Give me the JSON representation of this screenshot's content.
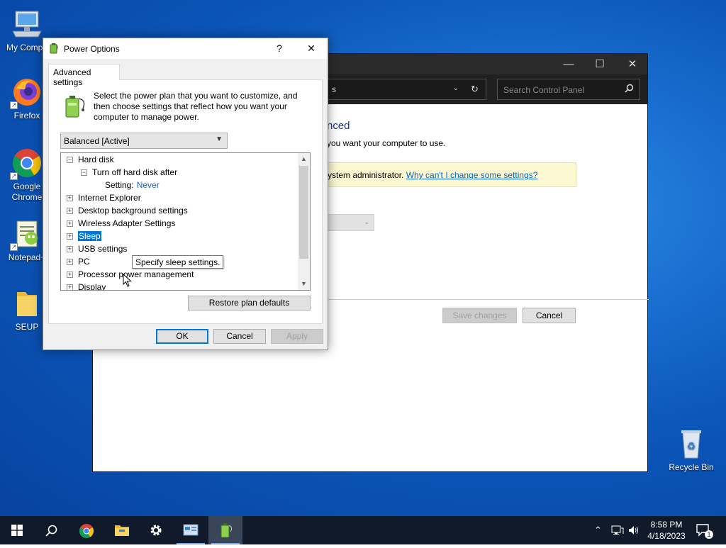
{
  "desktop": {
    "icons": [
      {
        "label": "My Compu",
        "icon": "computer-icon"
      },
      {
        "label": "Firefox",
        "icon": "firefox-icon"
      },
      {
        "label": "Google Chrome",
        "icon": "chrome-icon"
      },
      {
        "label": "Notepad+",
        "icon": "notepadpp-icon"
      },
      {
        "label": "SEUP",
        "icon": "folder-icon"
      },
      {
        "label": "Recycle Bin",
        "icon": "recycle-bin-icon"
      }
    ]
  },
  "control_panel": {
    "address_text": "s",
    "search_placeholder": "Search Control Panel",
    "title": "nced",
    "description": "you want your computer to use.",
    "info_text": "ystem administrator. ",
    "info_link": "Why can't I change some settings?",
    "save_label": "Save changes",
    "cancel_label": "Cancel"
  },
  "dialog": {
    "title": "Power Options",
    "help_glyph": "?",
    "close_glyph": "✕",
    "tab_label": "Advanced settings",
    "description": "Select the power plan that you want to customize, and then choose settings that reflect how you want your computer to manage power.",
    "plan_selected": "Balanced [Active]",
    "tree": {
      "hard_disk": "Hard disk",
      "turn_off_hard_disk": "Turn off hard disk after",
      "setting_label": "Setting:",
      "setting_value": "Never",
      "internet_explorer": "Internet Explorer",
      "desktop_background": "Desktop background settings",
      "wireless_adapter": "Wireless Adapter Settings",
      "sleep": "Sleep",
      "usb": "USB settings",
      "pci": "PC",
      "processor": "Processor power management",
      "display": "Display"
    },
    "tooltip": "Specify sleep settings.",
    "restore_label": "Restore plan defaults",
    "ok_label": "OK",
    "cancel_label": "Cancel",
    "apply_label": "Apply"
  },
  "taskbar": {
    "time": "8:58 PM",
    "date": "4/18/2023",
    "notification_count": "1",
    "apps": [
      "start-icon",
      "search-icon",
      "chrome-icon",
      "file-explorer-icon",
      "settings-icon",
      "control-panel-icon",
      "power-options-icon"
    ]
  },
  "colors": {
    "accent": "#0078d7",
    "link": "#0066cc",
    "setting_value": "#1e61c9",
    "desktop": "#0b56b8",
    "taskbar": "#101a2b"
  }
}
